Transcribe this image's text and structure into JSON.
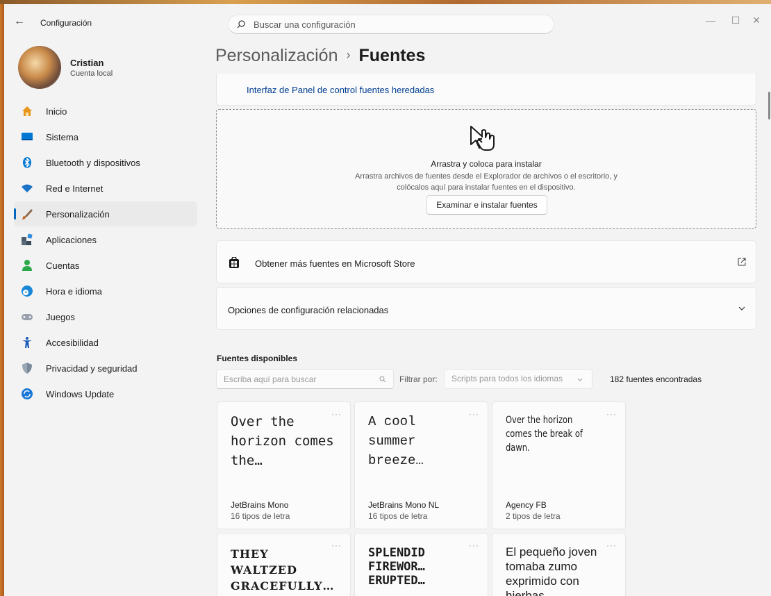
{
  "window": {
    "app_title": "Configuración",
    "controls": {
      "minimize": "—",
      "maximize": "☐",
      "close": "✕"
    }
  },
  "search": {
    "placeholder": "Buscar una configuración"
  },
  "profile": {
    "name": "Cristian",
    "account": "Cuenta local"
  },
  "sidebar": {
    "items": [
      {
        "label": "Inicio",
        "icon": "home-icon",
        "color": "#e8951b"
      },
      {
        "label": "Sistema",
        "icon": "system-icon",
        "color": "#0078d4"
      },
      {
        "label": "Bluetooth y dispositivos",
        "icon": "bluetooth-icon",
        "color": "#0078d4"
      },
      {
        "label": "Red e Internet",
        "icon": "wifi-icon",
        "color": "#1a73c7"
      },
      {
        "label": "Personalización",
        "icon": "brush-icon",
        "color": "#c46a2a"
      },
      {
        "label": "Aplicaciones",
        "icon": "apps-icon",
        "color": "#4a5a6a"
      },
      {
        "label": "Cuentas",
        "icon": "account-icon",
        "color": "#2aa84a"
      },
      {
        "label": "Hora e idioma",
        "icon": "time-language-icon",
        "color": "#1a88d8"
      },
      {
        "label": "Juegos",
        "icon": "gamepad-icon",
        "color": "#8a8a9a"
      },
      {
        "label": "Accesibilidad",
        "icon": "accessibility-icon",
        "color": "#1a5ab8"
      },
      {
        "label": "Privacidad y seguridad",
        "icon": "shield-icon",
        "color": "#7a8a9a"
      },
      {
        "label": "Windows Update",
        "icon": "update-icon",
        "color": "#1a78d8"
      }
    ],
    "selected_index": 4
  },
  "main": {
    "breadcrumb_parent": "Personalización",
    "breadcrumb_sep": "›",
    "page_title": "Fuentes",
    "legacy_link": "Interfaz de Panel de control fuentes heredadas",
    "dropzone": {
      "title": "Arrastra y coloca para instalar",
      "desc_line1": "Arrastra archivos de fuentes desde el Explorador de archivos o el escritorio, y",
      "desc_line2": "colócalos aquí para instalar fuentes en el dispositivo.",
      "button": "Examinar e instalar fuentes"
    },
    "store_link": "Obtener más fuentes en Microsoft Store",
    "related": "Opciones de configuración relacionadas",
    "available": {
      "title": "Fuentes disponibles",
      "search_placeholder": "Escriba aquí para buscar",
      "filter_label": "Filtrar por:",
      "filter_value": "Scripts para todos los idiomas",
      "count": "182 fuentes encontradas"
    },
    "fonts": [
      {
        "sample": "Over the horizon comes the…",
        "name": "JetBrains Mono",
        "styles": "16 tipos de letra"
      },
      {
        "sample": "A cool summer breeze…",
        "name": "JetBrains Mono NL",
        "styles": "16 tipos de letra"
      },
      {
        "sample": "Over the horizon comes the break of dawn.",
        "name": "Agency FB",
        "styles": "2 tipos de letra"
      },
      {
        "sample": "THEY WALTZED GRACEFULLY…",
        "name": "",
        "styles": ""
      },
      {
        "sample": "SPLENDID FIREWOR… ERUPTED…",
        "name": "",
        "styles": ""
      },
      {
        "sample": "El pequeño joven tomaba zumo exprimido con hierbas",
        "name": "",
        "styles": ""
      }
    ],
    "more_glyph": "···"
  },
  "colors": {
    "accent": "#0067c0",
    "link": "#003e92",
    "background": "#f3f3f3",
    "card": "#fbfbfb"
  }
}
